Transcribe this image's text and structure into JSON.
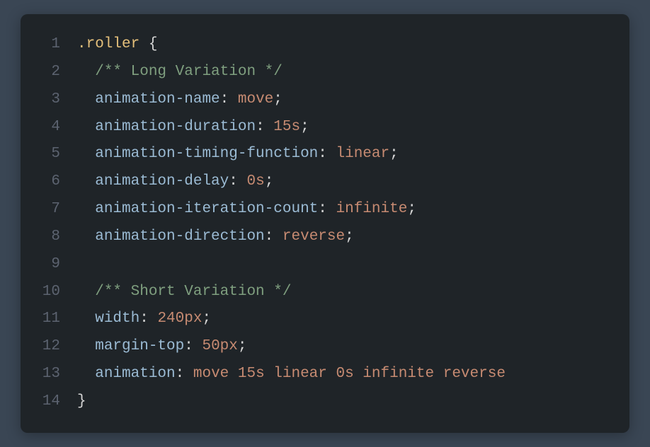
{
  "code": {
    "lines": [
      {
        "n": "1",
        "tokens": [
          {
            "cls": "selector",
            "t": ".roller "
          },
          {
            "cls": "brace",
            "t": "{"
          }
        ]
      },
      {
        "n": "2",
        "tokens": [
          {
            "cls": "",
            "t": "  "
          },
          {
            "cls": "comment",
            "t": "/** Long Variation */"
          }
        ]
      },
      {
        "n": "3",
        "tokens": [
          {
            "cls": "",
            "t": "  "
          },
          {
            "cls": "property",
            "t": "animation-name"
          },
          {
            "cls": "punct",
            "t": ": "
          },
          {
            "cls": "value",
            "t": "move"
          },
          {
            "cls": "punct",
            "t": ";"
          }
        ]
      },
      {
        "n": "4",
        "tokens": [
          {
            "cls": "",
            "t": "  "
          },
          {
            "cls": "property",
            "t": "animation-duration"
          },
          {
            "cls": "punct",
            "t": ": "
          },
          {
            "cls": "value",
            "t": "15s"
          },
          {
            "cls": "punct",
            "t": ";"
          }
        ]
      },
      {
        "n": "5",
        "tokens": [
          {
            "cls": "",
            "t": "  "
          },
          {
            "cls": "property",
            "t": "animation-timing-function"
          },
          {
            "cls": "punct",
            "t": ": "
          },
          {
            "cls": "value",
            "t": "linear"
          },
          {
            "cls": "punct",
            "t": ";"
          }
        ]
      },
      {
        "n": "6",
        "tokens": [
          {
            "cls": "",
            "t": "  "
          },
          {
            "cls": "property",
            "t": "animation-delay"
          },
          {
            "cls": "punct",
            "t": ": "
          },
          {
            "cls": "value",
            "t": "0s"
          },
          {
            "cls": "punct",
            "t": ";"
          }
        ]
      },
      {
        "n": "7",
        "tokens": [
          {
            "cls": "",
            "t": "  "
          },
          {
            "cls": "property",
            "t": "animation-iteration-count"
          },
          {
            "cls": "punct",
            "t": ": "
          },
          {
            "cls": "value",
            "t": "infinite"
          },
          {
            "cls": "punct",
            "t": ";"
          }
        ]
      },
      {
        "n": "8",
        "tokens": [
          {
            "cls": "",
            "t": "  "
          },
          {
            "cls": "property",
            "t": "animation-direction"
          },
          {
            "cls": "punct",
            "t": ": "
          },
          {
            "cls": "value",
            "t": "reverse"
          },
          {
            "cls": "punct",
            "t": ";"
          }
        ]
      },
      {
        "n": "9",
        "tokens": []
      },
      {
        "n": "10",
        "tokens": [
          {
            "cls": "",
            "t": "  "
          },
          {
            "cls": "comment",
            "t": "/** Short Variation */"
          }
        ]
      },
      {
        "n": "11",
        "tokens": [
          {
            "cls": "",
            "t": "  "
          },
          {
            "cls": "property",
            "t": "width"
          },
          {
            "cls": "punct",
            "t": ": "
          },
          {
            "cls": "value",
            "t": "240px"
          },
          {
            "cls": "punct",
            "t": ";"
          }
        ]
      },
      {
        "n": "12",
        "tokens": [
          {
            "cls": "",
            "t": "  "
          },
          {
            "cls": "property",
            "t": "margin-top"
          },
          {
            "cls": "punct",
            "t": ": "
          },
          {
            "cls": "value",
            "t": "50px"
          },
          {
            "cls": "punct",
            "t": ";"
          }
        ]
      },
      {
        "n": "13",
        "tokens": [
          {
            "cls": "",
            "t": "  "
          },
          {
            "cls": "property",
            "t": "animation"
          },
          {
            "cls": "punct",
            "t": ": "
          },
          {
            "cls": "value",
            "t": "move 15s linear 0s infinite reverse"
          }
        ]
      },
      {
        "n": "14",
        "tokens": [
          {
            "cls": "brace",
            "t": "}"
          }
        ]
      }
    ]
  }
}
